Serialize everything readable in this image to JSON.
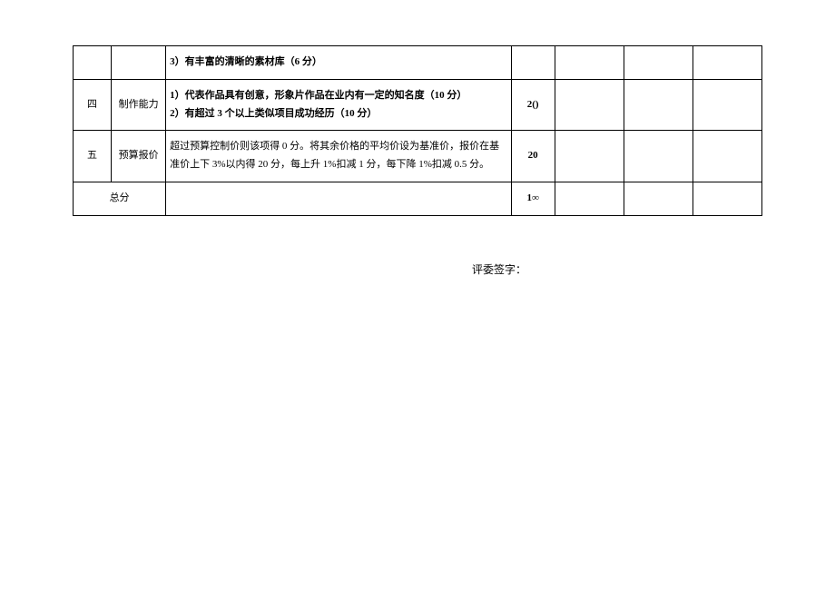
{
  "rows": {
    "material": {
      "desc": "3）有丰富的清晰的素材库（6 分）"
    },
    "four": {
      "num": "四",
      "category": "制作能力",
      "desc_line1": "1）代表作品具有创意，形象片作品在业内有一定的知名度（10 分）",
      "desc_line2": "2）有超过 3 个以上类似项目成功经历（10 分）",
      "score": "2()"
    },
    "five": {
      "num": "五",
      "category": "预算报价",
      "desc": "超过预算控制价则该项得 0 分。将其余价格的平均价设为基准价，报价在基准价上下 3%以内得 20 分，每上升 1%扣减 1 分，每下降 1%扣减 0.5 分。",
      "score": "20"
    },
    "total": {
      "label": "总分",
      "score": "1∞"
    }
  },
  "signature_label": "评委签字："
}
